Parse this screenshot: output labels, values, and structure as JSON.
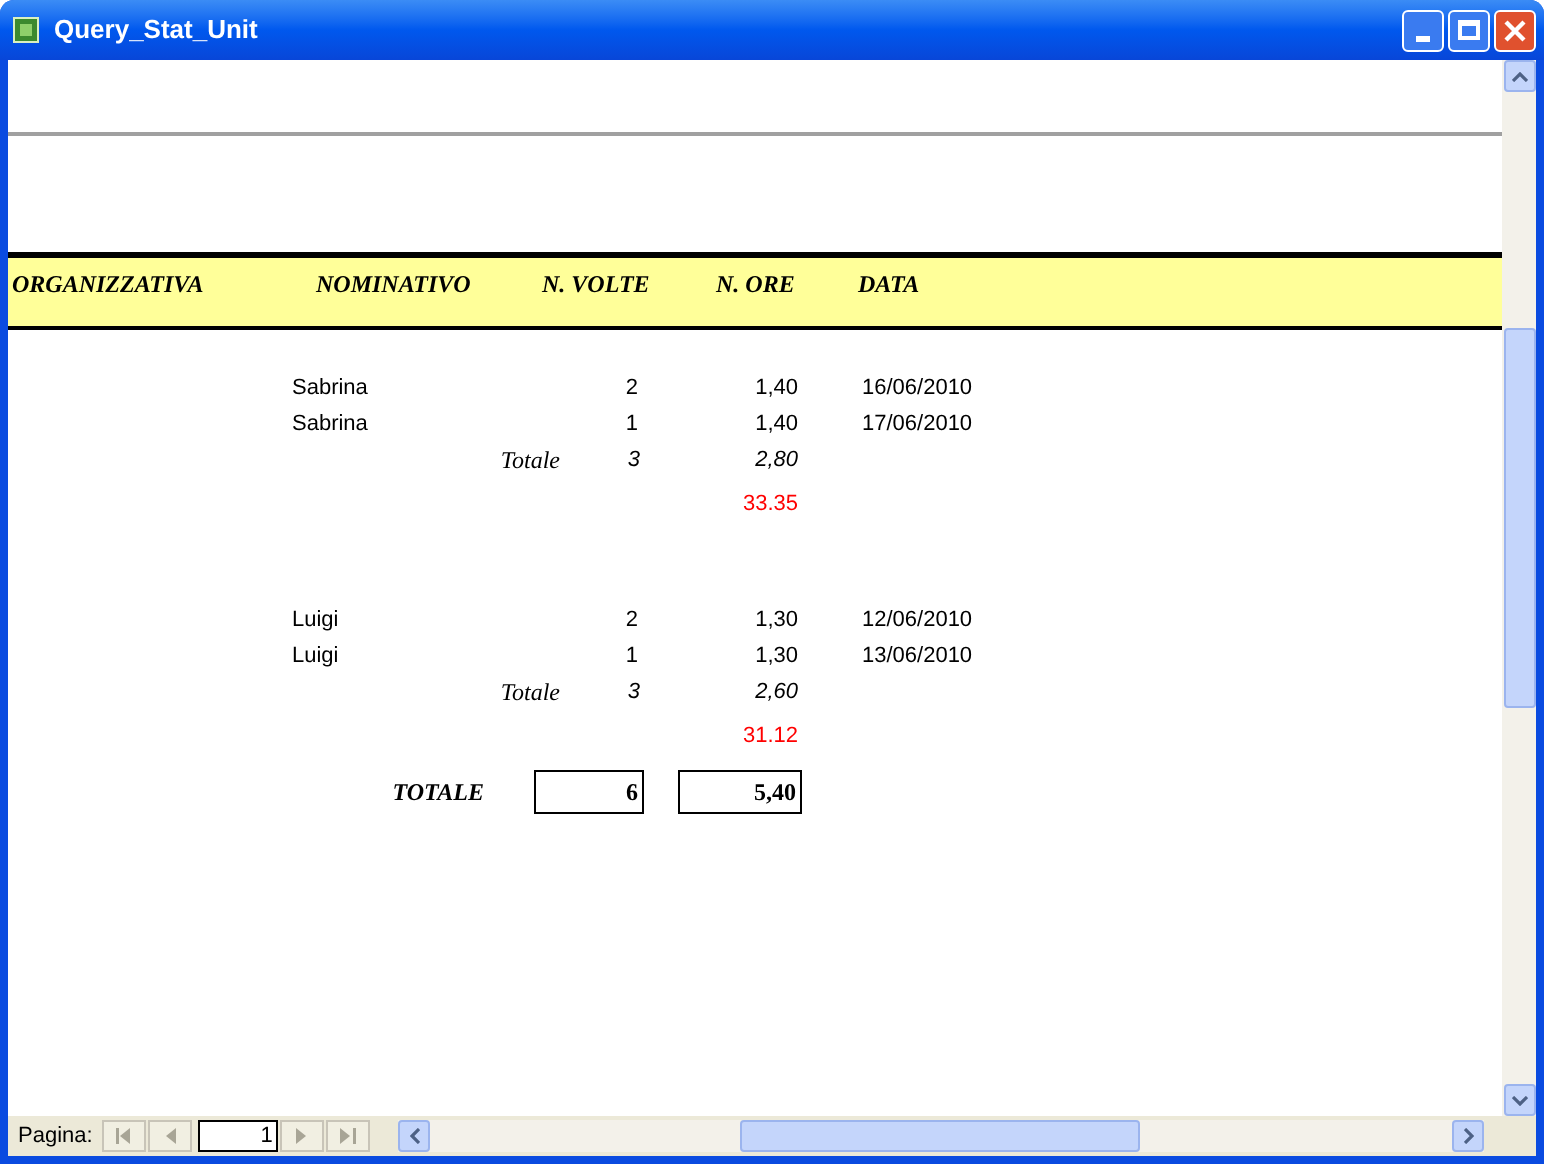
{
  "window": {
    "title": "Query_Stat_Unit"
  },
  "report": {
    "columns": [
      "ORGANIZZATIVA",
      "NOMINATIVO",
      "N. VOLTE",
      "N. ORE",
      "DATA"
    ],
    "groups": [
      {
        "rows": [
          {
            "name": "Sabrina",
            "volte": "2",
            "ore": "1,40",
            "data": "16/06/2010"
          },
          {
            "name": "Sabrina",
            "volte": "1",
            "ore": "1,40",
            "data": "17/06/2010"
          }
        ],
        "subtotal": {
          "label": "Totale",
          "volte": "3",
          "ore": "2,80"
        },
        "extra": "33.35"
      },
      {
        "rows": [
          {
            "name": "Luigi",
            "volte": "2",
            "ore": "1,30",
            "data": "12/06/2010"
          },
          {
            "name": "Luigi",
            "volte": "1",
            "ore": "1,30",
            "data": "13/06/2010"
          }
        ],
        "subtotal": {
          "label": "Totale",
          "volte": "3",
          "ore": "2,60"
        },
        "extra": "31.12"
      }
    ],
    "grand_total": {
      "label": "TOTALE",
      "volte": "6",
      "ore": "5,40"
    }
  },
  "pager": {
    "label": "Pagina:",
    "page": "1"
  }
}
